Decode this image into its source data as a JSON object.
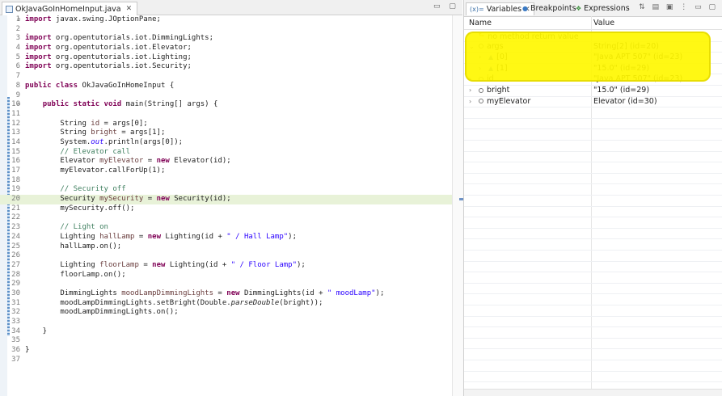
{
  "editor": {
    "tab_label": "OkJavaGoInHomeInput.java",
    "tab_close": "✕",
    "window_buttons": "▭ ▢",
    "lines": [
      {
        "n": "1",
        "fold": "⊖",
        "segs": [
          {
            "c": "kw",
            "t": "import"
          },
          {
            "c": "",
            "t": " javax.swing.JOptionPane;"
          }
        ]
      },
      {
        "n": "2",
        "segs": []
      },
      {
        "n": "3",
        "segs": [
          {
            "c": "kw",
            "t": "import"
          },
          {
            "c": "",
            "t": " org.opentutorials.iot.DimmingLights;"
          }
        ]
      },
      {
        "n": "4",
        "segs": [
          {
            "c": "kw",
            "t": "import"
          },
          {
            "c": "",
            "t": " org.opentutorials.iot.Elevator;"
          }
        ]
      },
      {
        "n": "5",
        "segs": [
          {
            "c": "kw",
            "t": "import"
          },
          {
            "c": "",
            "t": " org.opentutorials.iot.Lighting;"
          }
        ]
      },
      {
        "n": "6",
        "segs": [
          {
            "c": "kw",
            "t": "import"
          },
          {
            "c": "",
            "t": " org.opentutorials.iot.Security;"
          }
        ]
      },
      {
        "n": "7",
        "segs": []
      },
      {
        "n": "8",
        "segs": [
          {
            "c": "kw",
            "t": "public class"
          },
          {
            "c": "",
            "t": " OkJavaGoInHomeInput {"
          }
        ]
      },
      {
        "n": "9",
        "segs": []
      },
      {
        "n": "10",
        "fold": "⊖",
        "segs": [
          {
            "c": "",
            "t": "    "
          },
          {
            "c": "kw",
            "t": "public static void"
          },
          {
            "c": "",
            "t": " main(String[] args) {"
          }
        ]
      },
      {
        "n": "11",
        "segs": []
      },
      {
        "n": "12",
        "segs": [
          {
            "c": "",
            "t": "        String "
          },
          {
            "c": "vr",
            "t": "id"
          },
          {
            "c": "",
            "t": " = args[0];"
          }
        ]
      },
      {
        "n": "13",
        "segs": [
          {
            "c": "",
            "t": "        String "
          },
          {
            "c": "vr",
            "t": "bright"
          },
          {
            "c": "",
            "t": " = args[1];"
          }
        ]
      },
      {
        "n": "14",
        "segs": [
          {
            "c": "",
            "t": "        System."
          },
          {
            "c": "st it",
            "t": "out"
          },
          {
            "c": "",
            "t": ".println(args[0]);"
          }
        ]
      },
      {
        "n": "15",
        "segs": [
          {
            "c": "cm",
            "t": "        // Elevator call"
          }
        ]
      },
      {
        "n": "16",
        "segs": [
          {
            "c": "",
            "t": "        Elevator "
          },
          {
            "c": "vr",
            "t": "myElevator"
          },
          {
            "c": "",
            "t": " = "
          },
          {
            "c": "kw",
            "t": "new"
          },
          {
            "c": "",
            "t": " Elevator(id);"
          }
        ]
      },
      {
        "n": "17",
        "segs": [
          {
            "c": "",
            "t": "        myElevator.callForUp(1);"
          }
        ]
      },
      {
        "n": "18",
        "segs": []
      },
      {
        "n": "19",
        "segs": [
          {
            "c": "cm",
            "t": "        // Security off"
          }
        ]
      },
      {
        "n": "20",
        "hl": true,
        "segs": [
          {
            "c": "",
            "t": "        Security "
          },
          {
            "c": "vr",
            "t": "mySecurity"
          },
          {
            "c": "",
            "t": " = "
          },
          {
            "c": "kw",
            "t": "new"
          },
          {
            "c": "",
            "t": " Security(id);"
          }
        ]
      },
      {
        "n": "21",
        "segs": [
          {
            "c": "",
            "t": "        mySecurity.off();"
          }
        ]
      },
      {
        "n": "22",
        "segs": []
      },
      {
        "n": "23",
        "segs": [
          {
            "c": "cm",
            "t": "        // Light on"
          }
        ]
      },
      {
        "n": "24",
        "segs": [
          {
            "c": "",
            "t": "        Lighting "
          },
          {
            "c": "vr",
            "t": "hallLamp"
          },
          {
            "c": "",
            "t": " = "
          },
          {
            "c": "kw",
            "t": "new"
          },
          {
            "c": "",
            "t": " Lighting(id + "
          },
          {
            "c": "st",
            "t": "\" / Hall Lamp\""
          },
          {
            "c": "",
            "t": ");"
          }
        ]
      },
      {
        "n": "25",
        "segs": [
          {
            "c": "",
            "t": "        hallLamp.on();"
          }
        ]
      },
      {
        "n": "26",
        "segs": []
      },
      {
        "n": "27",
        "segs": [
          {
            "c": "",
            "t": "        Lighting "
          },
          {
            "c": "vr",
            "t": "floorLamp"
          },
          {
            "c": "",
            "t": " = "
          },
          {
            "c": "kw",
            "t": "new"
          },
          {
            "c": "",
            "t": " Lighting(id + "
          },
          {
            "c": "st",
            "t": "\" / Floor Lamp\""
          },
          {
            "c": "",
            "t": ");"
          }
        ]
      },
      {
        "n": "28",
        "segs": [
          {
            "c": "",
            "t": "        floorLamp.on();"
          }
        ]
      },
      {
        "n": "29",
        "segs": []
      },
      {
        "n": "30",
        "segs": [
          {
            "c": "",
            "t": "        DimmingLights "
          },
          {
            "c": "vr",
            "t": "moodLampDimmingLights"
          },
          {
            "c": "",
            "t": " = "
          },
          {
            "c": "kw",
            "t": "new"
          },
          {
            "c": "",
            "t": " DimmingLights(id + "
          },
          {
            "c": "st",
            "t": "\" moodLamp\""
          },
          {
            "c": "",
            "t": ");"
          }
        ]
      },
      {
        "n": "31",
        "segs": [
          {
            "c": "",
            "t": "        moodLampDimmingLights.setBright(Double."
          },
          {
            "c": "it",
            "t": "parseDouble"
          },
          {
            "c": "",
            "t": "(bright));"
          }
        ]
      },
      {
        "n": "32",
        "segs": [
          {
            "c": "",
            "t": "        moodLampDimmingLights.on();"
          }
        ]
      },
      {
        "n": "33",
        "segs": []
      },
      {
        "n": "34",
        "segs": [
          {
            "c": "",
            "t": "    }"
          }
        ]
      },
      {
        "n": "35",
        "segs": []
      },
      {
        "n": "36",
        "segs": [
          {
            "c": "",
            "t": "}"
          }
        ]
      },
      {
        "n": "37",
        "segs": []
      }
    ]
  },
  "view": {
    "tabs": [
      {
        "icon": "(x)=",
        "label": "Variables",
        "close": "✕",
        "active": true
      },
      {
        "icon": "●",
        "label": "Breakpoints",
        "close": "",
        "active": false
      },
      {
        "icon": "❖",
        "label": "Expressions",
        "close": "",
        "active": false
      }
    ],
    "toolbar_glyphs": "⇅ ▤ ▣ ⋮ ▭ ▢",
    "col_name": "Name",
    "col_value": "Value",
    "rows": [
      {
        "indent": 0,
        "twisty": "",
        "icon": "ret",
        "name": "no method return value",
        "value": ""
      },
      {
        "indent": 0,
        "twisty": "⌄",
        "icon": "dot",
        "name": "args",
        "value": "String[2]  (id=20)"
      },
      {
        "indent": 1,
        "twisty": "›",
        "icon": "tri",
        "name": "[0]",
        "value": "\"Java APT 507\" (id=23)"
      },
      {
        "indent": 1,
        "twisty": "›",
        "icon": "tri",
        "name": "[1]",
        "value": "\"15.0\" (id=29)"
      },
      {
        "indent": 0,
        "twisty": "›",
        "icon": "dot",
        "name": "id",
        "value": "\"Java APT 507\" (id=23)"
      },
      {
        "indent": 0,
        "twisty": "›",
        "icon": "dot",
        "name": "bright",
        "value": "\"15.0\" (id=29)"
      },
      {
        "indent": 0,
        "twisty": "›",
        "icon": "dot",
        "name": "myElevator",
        "value": "Elevator  (id=30)"
      }
    ]
  }
}
